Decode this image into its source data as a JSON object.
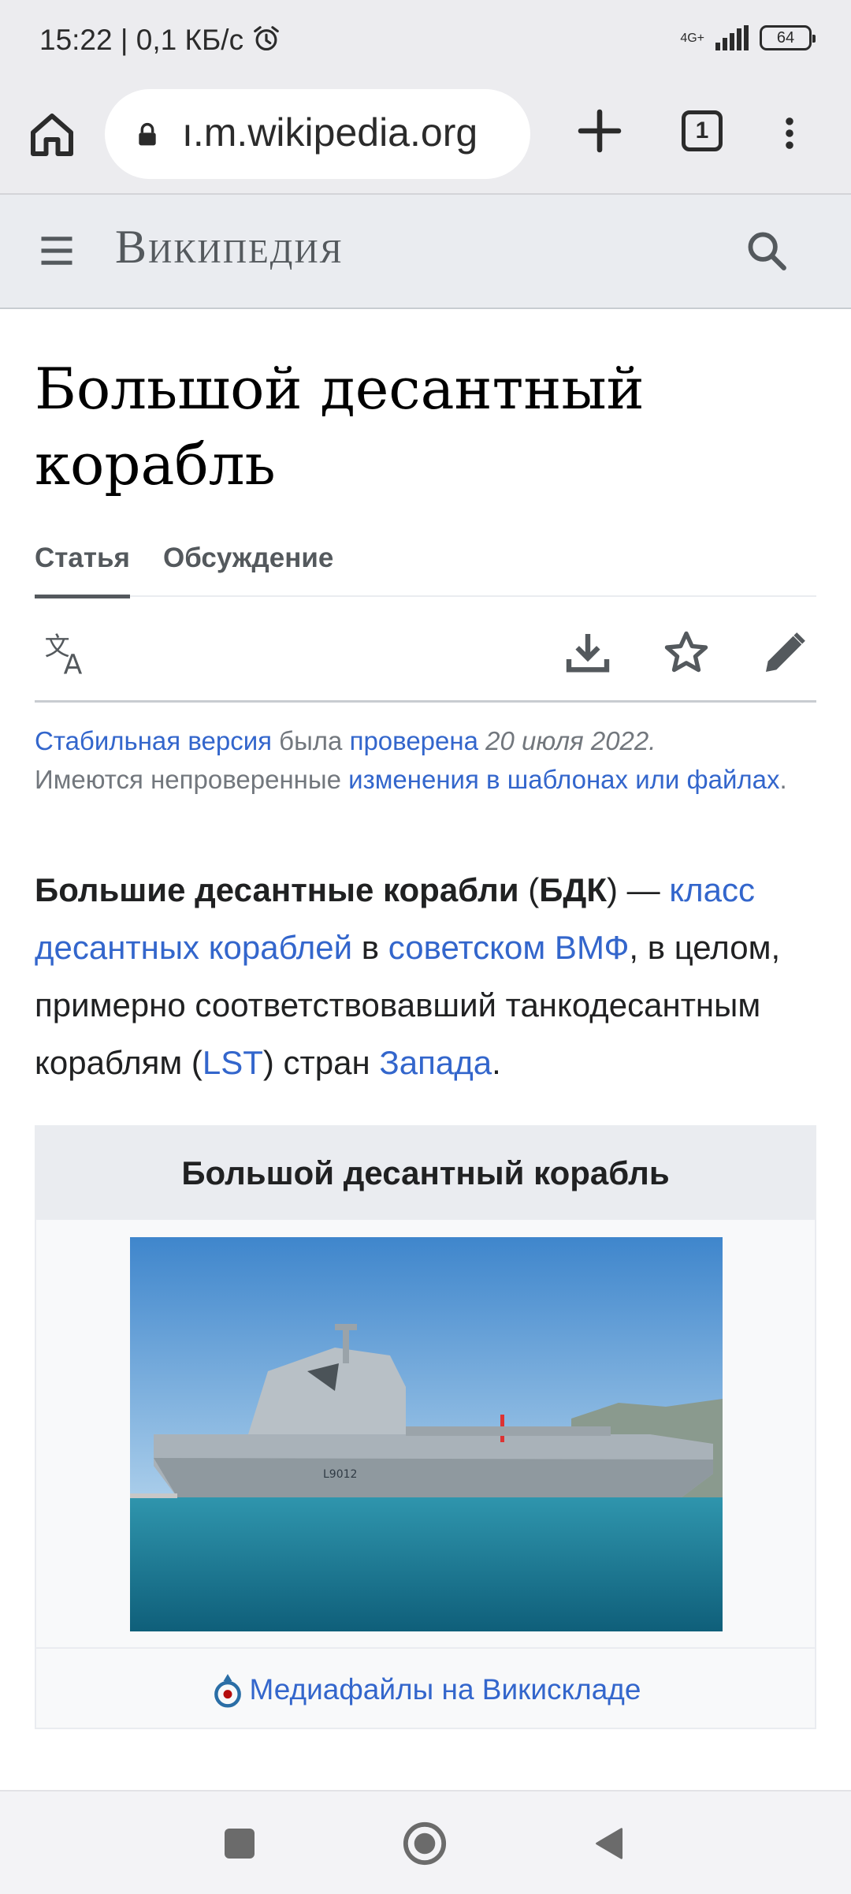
{
  "status_bar": {
    "time_speed": "15:22 | 0,1 КБ/с",
    "network": "4G+",
    "battery": "64"
  },
  "browser": {
    "url": "ı.m.wikipedia.org",
    "tab_count": "1"
  },
  "wiki_header": {
    "logo": "Википедия"
  },
  "article": {
    "title": "Большой десантный корабль",
    "tabs": [
      "Статья",
      "Обсуждение"
    ]
  },
  "notice": {
    "link1": "Стабильная версия",
    "text1": " была ",
    "link2": "проверена",
    "date": " 20 июля 2022.",
    "text2": "Имеются непроверенные ",
    "link3": "изменения в шаблонах или файлах",
    "end": "."
  },
  "lead": {
    "bold": "Большие десантные корабли",
    "t1": " (",
    "bold2": "БДК",
    "t2": ") — ",
    "link1": "класс десантных кораблей",
    "t3": " в ",
    "link2": "советском ВМФ",
    "t4": ", в целом, примерно соответствовавший танкодесантным кораблям (",
    "link3": "LST",
    "t5": ") стран ",
    "link4": "Запада",
    "t6": "."
  },
  "infobox": {
    "header": "Большой десантный корабль",
    "ship_label": "L9012",
    "commons_link": "Медиафайлы на Викискладе"
  }
}
